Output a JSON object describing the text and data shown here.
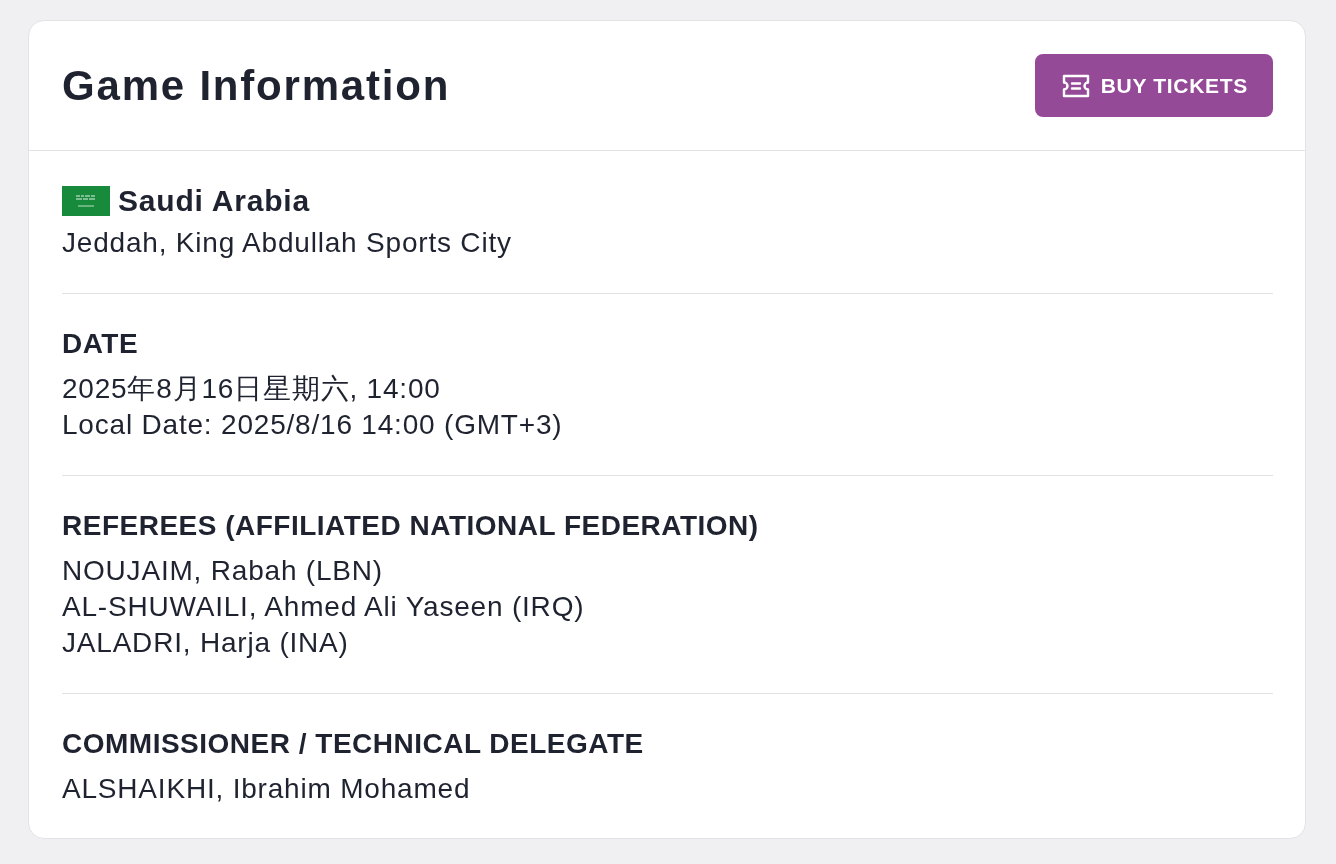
{
  "header": {
    "title": "Game Information",
    "button": {
      "label": "BUY TICKETS"
    }
  },
  "venue": {
    "country": "Saudi Arabia",
    "location": "Jeddah, King Abdullah Sports City"
  },
  "sections": [
    {
      "heading": "DATE",
      "lines": [
        "2025年8月16日星期六, 14:00",
        "Local Date: 2025/8/16 14:00 (GMT+3)"
      ]
    },
    {
      "heading": "REFEREES (AFFILIATED NATIONAL FEDERATION)",
      "lines": [
        "NOUJAIM, Rabah (LBN)",
        "AL-SHUWAILI, Ahmed Ali Yaseen (IRQ)",
        "JALADRI, Harja (INA)"
      ]
    },
    {
      "heading": "COMMISSIONER / TECHNICAL DELEGATE",
      "lines": [
        "ALSHAIKHI, Ibrahim Mohamed"
      ]
    }
  ]
}
